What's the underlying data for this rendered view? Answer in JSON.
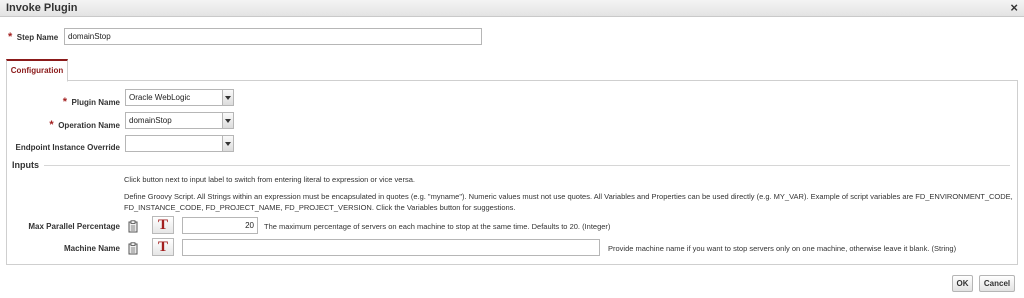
{
  "dialog": {
    "title": "Invoke Plugin",
    "close_glyph": "×"
  },
  "step": {
    "required_mark": "*",
    "label": "Step Name",
    "value": "domainStop"
  },
  "tabs": [
    {
      "label": "Configuration",
      "active": true
    }
  ],
  "config": {
    "plugin": {
      "required_mark": "*",
      "label": "Plugin Name",
      "value": "Oracle WebLogic"
    },
    "operation": {
      "required_mark": "*",
      "label": "Operation Name",
      "value": "domainStop"
    },
    "endpoint": {
      "label": "Endpoint Instance Override",
      "value": ""
    }
  },
  "inputs": {
    "section_title": "Inputs",
    "help_line1": "Click button next to input label to switch from entering literal to expression or vice versa.",
    "help_line2": "Define Groovy Script. All Strings within an expression must be encapsulated in quotes (e.g. \"myname\"). Numeric values must not use quotes. All Variables and Properties can be used directly (e.g. MY_VAR). Example of script variables are FD_ENVIRONMENT_CODE,",
    "help_line3": "FD_INSTANCE_CODE, FD_PROJECT_NAME, FD_PROJECT_VERSION. Click the Variables button for suggestions.",
    "toggle_glyph": "T",
    "fields": [
      {
        "label": "Max Parallel Percentage",
        "value": "20",
        "description": "The maximum percentage of servers on each machine to stop at the same time. Defaults to 20. (Integer)"
      },
      {
        "label": "Machine Name",
        "value": "",
        "description": "Provide machine name if you want to stop servers only on one machine, otherwise leave it blank. (String)"
      }
    ]
  },
  "footer": {
    "ok_label": "OK",
    "cancel_label": "Cancel"
  },
  "colors": {
    "accent": "#8b1a1a",
    "required": "#a32020"
  }
}
